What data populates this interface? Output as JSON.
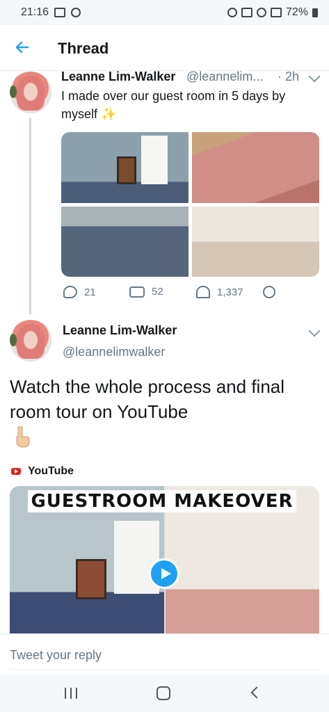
{
  "status_bar": {
    "time": "21:16",
    "battery": "72%"
  },
  "header": {
    "title": "Thread",
    "back_icon": "back-arrow-icon",
    "accent": "#1da1f2"
  },
  "tweet1": {
    "name": "Leanne Lim-Walker",
    "handle": "@leannelim...",
    "time": "· 2h",
    "text": "I made over our guest room in 5 days by myself ✨",
    "stats": {
      "replies": "21",
      "retweets": "52",
      "likes": "1,337"
    }
  },
  "tweet2": {
    "name": "Leanne Lim-Walker",
    "handle": "@leannelimwalker",
    "text": "Watch the whole process and final room tour on YouTube",
    "emoji": "👇",
    "card_source": "YouTube",
    "video_title": "GUESTROOM MAKEOVER"
  },
  "reply": {
    "placeholder": "Tweet your reply"
  }
}
